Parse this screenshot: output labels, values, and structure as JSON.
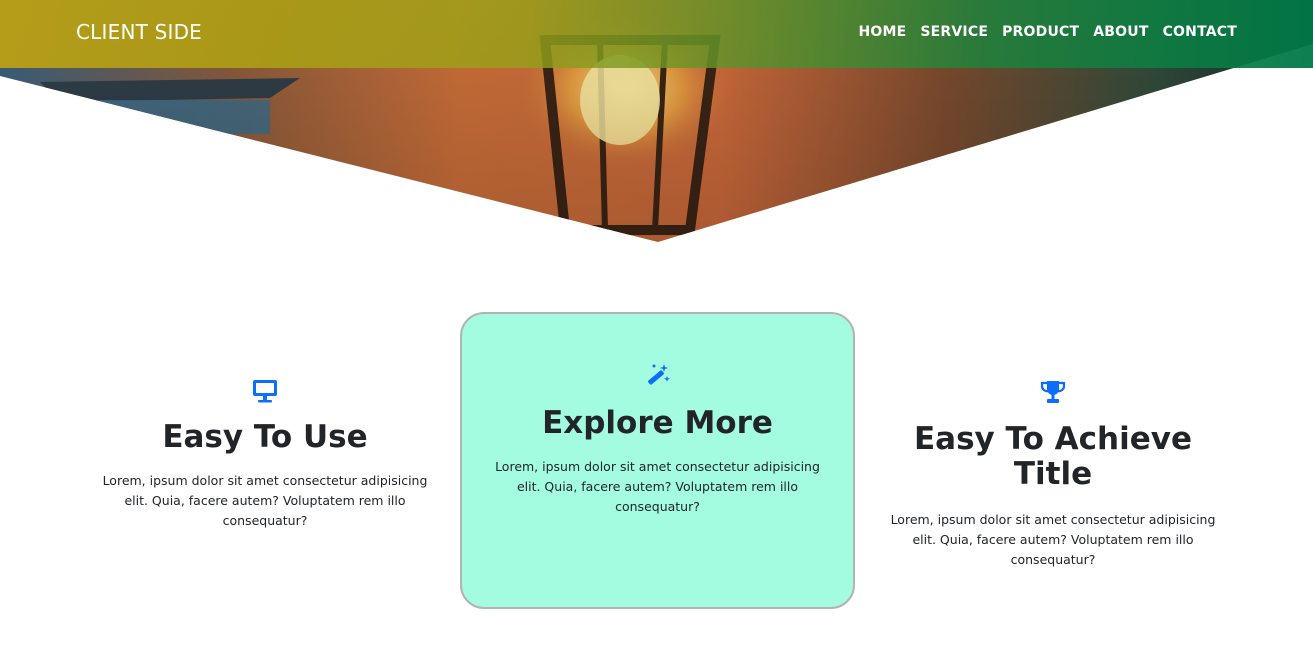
{
  "navbar": {
    "brand": "CLIENT SIDE",
    "links": [
      "HOME",
      "SERVICE",
      "PRODUCT",
      "ABOUT",
      "CONTACT"
    ]
  },
  "hero": {
    "image": "lantern-photo"
  },
  "features": [
    {
      "icon": "monitor-icon",
      "title": "Easy To Use",
      "text": "Lorem, ipsum dolor sit amet consectetur adipisicing elit. Quia, facere autem? Voluptatem rem illo consequatur?"
    },
    {
      "icon": "magic-wand-icon",
      "title": "Explore More",
      "text": "Lorem, ipsum dolor sit amet consectetur adipisicing elit. Quia, facere autem? Voluptatem rem illo consequatur?",
      "highlighted": true
    },
    {
      "icon": "trophy-icon",
      "title": "Easy To Achieve Title",
      "text": "Lorem, ipsum dolor sit amet consectetur adipisicing elit. Quia, facere autem? Voluptatem rem illo consequatur?"
    }
  ],
  "colors": {
    "accent": "#0d6efd",
    "card_bg": "#a3fcdf",
    "card_border": "#b3b3b3",
    "text": "#212529"
  }
}
